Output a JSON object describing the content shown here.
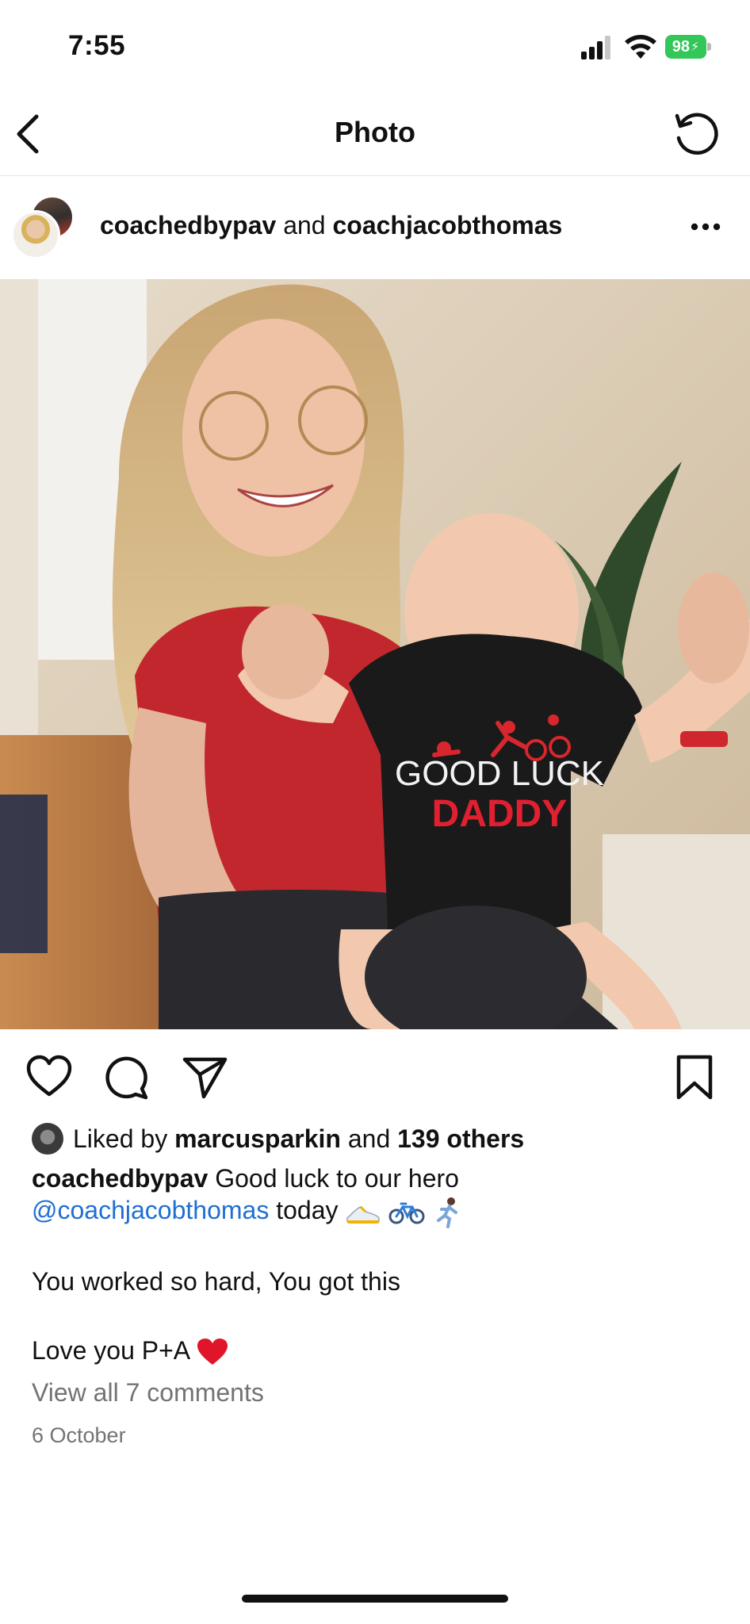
{
  "status_bar": {
    "time": "7:55",
    "battery": "98",
    "icons": [
      "signal-icon",
      "wifi-icon",
      "battery-charging-icon"
    ]
  },
  "header": {
    "title": "Photo",
    "back_icon": "chevron-left-icon",
    "refresh_icon": "refresh-icon"
  },
  "post": {
    "author_primary": "coachedbypav",
    "connector": "and",
    "author_secondary": "coachjacobthomas",
    "more_icon": "more-horizontal-icon",
    "photo_shirt_text": [
      "GOOD LUCK",
      "DADDY"
    ]
  },
  "actions": [
    "heart-icon",
    "comment-icon",
    "share-icon",
    "bookmark-icon"
  ],
  "likes": {
    "prefix": "Liked by",
    "user": "marcusparkin",
    "connector": "and",
    "others": "139 others"
  },
  "caption": {
    "author": "coachedbypav",
    "line1_text": "Good luck to our hero",
    "mention": "@coachjacobthomas",
    "line2_text": "today",
    "line2_emojis": [
      "shoe-emoji",
      "bicycle-emoji",
      "runner-emoji"
    ],
    "line3": "You worked so hard, You got this",
    "line4": "Love you P+A",
    "line4_emoji": "red-heart-emoji"
  },
  "comments_link": "View all 7 comments",
  "date": "6 October",
  "colors": {
    "mention": "#1f6fd1",
    "muted": "#737373",
    "battery": "#33c659",
    "heart": "#e0152b"
  }
}
